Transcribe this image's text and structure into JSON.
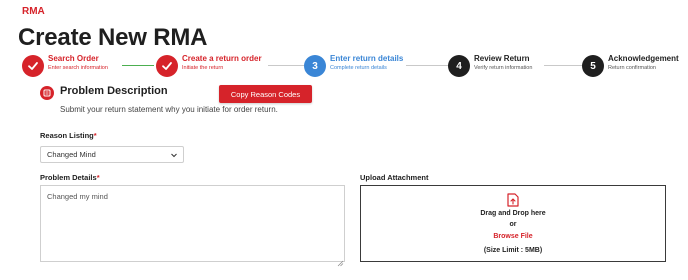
{
  "header": {
    "breadcrumb": "RMA",
    "title": "Create New RMA"
  },
  "steps": [
    {
      "title": "Search Order",
      "subtitle": "Enter search information",
      "state": "done",
      "number": ""
    },
    {
      "title": "Create a return order",
      "subtitle": "Initiate the return",
      "state": "done",
      "number": ""
    },
    {
      "title": "Enter return details",
      "subtitle": "Complete return details",
      "state": "active",
      "number": "3"
    },
    {
      "title": "Review Return",
      "subtitle": "Verify return information",
      "state": "todo",
      "number": "4"
    },
    {
      "title": "Acknowledgement",
      "subtitle": "Return confirmation",
      "state": "todo",
      "number": "5"
    }
  ],
  "problem_section": {
    "title": "Problem Description",
    "description": "Submit your return statement why you initiate for order return.",
    "copy_button": "Copy Reason Codes"
  },
  "form": {
    "reason_label": "Reason Listing",
    "reason_value": "Changed Mind",
    "details_label": "Problem Details",
    "details_value": "Changed my mind",
    "required_mark": "*"
  },
  "upload": {
    "label": "Upload Attachment",
    "drag_text": "Drag and Drop here",
    "or_text": "or",
    "browse_text": "Browse File",
    "limit_text": "(Size Limit : 5MB)"
  },
  "colors": {
    "accent": "#d6232a",
    "active_step": "#3a86d6",
    "todo_step": "#1f1f1f",
    "done_connector": "#4caf50"
  }
}
